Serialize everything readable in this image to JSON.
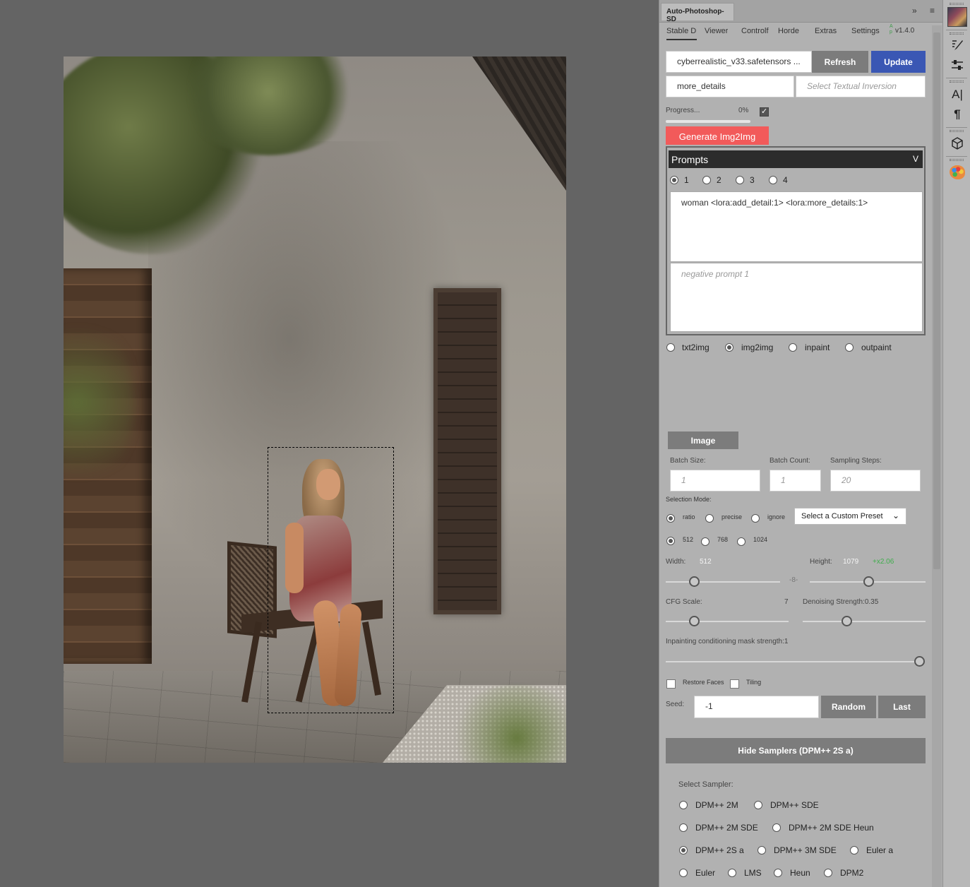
{
  "panel": {
    "title": "Auto-Photoshop-SD",
    "tabs": [
      "Stable Di",
      "Viewer",
      "Controlf",
      "Horde",
      "Extras",
      "Settings"
    ],
    "version": "v1.4.0",
    "version_badge": "A\np",
    "model_value": "cyberrealistic_v33.safetensors ...",
    "refresh_label": "Refresh",
    "update_label": "Update",
    "lora_value": "more_details",
    "textual_inversion_placeholder": "Select Textual Inversion",
    "progress_label": "Progress...",
    "progress_value": "0%",
    "progress_fraction": 0,
    "generate_label": "Generate Img2Img",
    "prompts_title": "Prompts",
    "prompt_tabs": [
      "1",
      "2",
      "3",
      "4"
    ],
    "selected_prompt_tab": "1",
    "positive_prompt": "woman <lora:add_detail:1> <lora:more_details:1>",
    "negative_prompt_placeholder": "negative prompt 1",
    "modes": [
      "txt2img",
      "img2img",
      "inpaint",
      "outpaint"
    ],
    "selected_mode": "img2img",
    "image_button": "Image",
    "batch_size_label": "Batch Size:",
    "batch_size_value": "1",
    "batch_count_label": "Batch Count:",
    "batch_count_value": "1",
    "sampling_steps_label": "Sampling Steps:",
    "sampling_steps_value": "20",
    "selection_mode_label": "Selection Mode:",
    "selection_modes": [
      "ratio",
      "precise",
      "ignore"
    ],
    "selected_selection_mode": "ratio",
    "preset_select": "Select a Custom Preset",
    "resolutions": [
      "512",
      "768",
      "1024"
    ],
    "selected_resolution": "512",
    "width_label": "Width:",
    "width_value": "512",
    "height_label": "Height:",
    "height_value": "1079",
    "scale_factor": "+x2.06",
    "cfg_label": "CFG Scale:",
    "cfg_value": "7",
    "denoising_label": "Denoising Strength:0.35",
    "inpaint_mask_label": "Inpainting conditioning mask strength:1",
    "restore_faces_label": "Restore Faces",
    "tiling_label": "Tiling",
    "seed_label": "Seed:",
    "seed_value": "-1",
    "random_label": "Random",
    "last_label": "Last",
    "hide_samplers_label": "Hide Samplers (DPM++ 2S a)",
    "select_sampler_label": "Select Sampler:",
    "samplers": [
      [
        "DPM++ 2M",
        "DPM++ SDE"
      ],
      [
        "DPM++ 2M SDE",
        "DPM++ 2M SDE Heun"
      ],
      [
        "DPM++ 2S a",
        "DPM++ 3M SDE",
        "Euler a"
      ],
      [
        "Euler",
        "LMS",
        "Heun",
        "DPM2"
      ]
    ],
    "selected_sampler": "DPM++ 2S a",
    "header_icons": [
      "double-chevron-icon",
      "menu-icon"
    ]
  },
  "toolbar": {
    "tools": [
      "app-thumbnail",
      "brush-settings-icon",
      "adjustments-icon",
      "character-icon",
      "paragraph-icon",
      "3d-cube-icon",
      "palette-icon"
    ]
  },
  "colors": {
    "update_button": "#3a57b4",
    "generate_button": "#f25a5a",
    "scale_factor": "#3fae4c",
    "workspace": "#646464",
    "panel": "#b1b1b1"
  }
}
